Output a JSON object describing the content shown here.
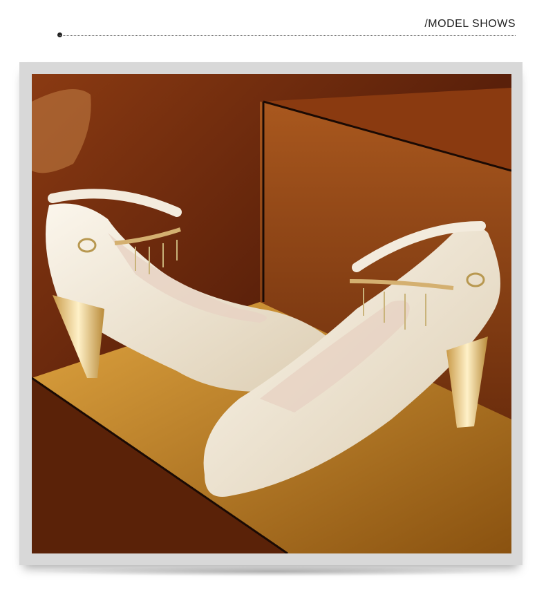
{
  "header": {
    "title": "/MODEL SHOWS"
  },
  "photo": {
    "subject_icon": "heels-photo",
    "colors": {
      "background": "#6a2a0c",
      "platform": "#c98a2a",
      "shoe": "#efe6d6",
      "heel": "#d9b060"
    }
  }
}
